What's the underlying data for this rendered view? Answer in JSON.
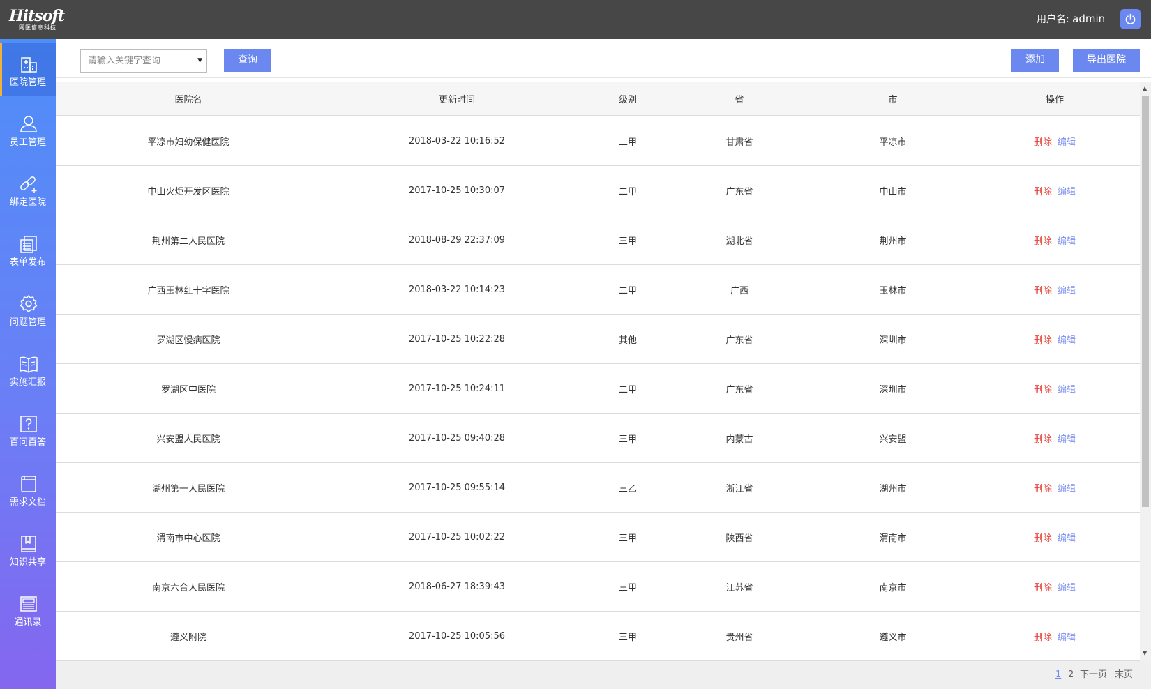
{
  "header": {
    "logo_text": "Hitsoft",
    "logo_sub": "网医信息科技",
    "user_label": "用户名:",
    "user_name": "admin"
  },
  "sidebar": {
    "items": [
      {
        "label": "医院管理",
        "icon": "hospital-icon",
        "active": true
      },
      {
        "label": "员工管理",
        "icon": "user-icon"
      },
      {
        "label": "绑定医院",
        "icon": "link-icon"
      },
      {
        "label": "表单发布",
        "icon": "forms-icon"
      },
      {
        "label": "问题管理",
        "icon": "gear-icon"
      },
      {
        "label": "实施汇报",
        "icon": "book-open-icon"
      },
      {
        "label": "百问百答",
        "icon": "question-icon"
      },
      {
        "label": "需求文档",
        "icon": "document-icon"
      },
      {
        "label": "知识共享",
        "icon": "bookmark-book-icon"
      },
      {
        "label": "通讯录",
        "icon": "newspaper-icon"
      }
    ]
  },
  "toolbar": {
    "search_placeholder": "请输入关键字查询",
    "query_label": "查询",
    "add_label": "添加",
    "export_label": "导出医院"
  },
  "table": {
    "columns": [
      "医院名",
      "更新时间",
      "级别",
      "省",
      "市",
      "操作"
    ],
    "rows": [
      {
        "name": "平凉市妇幼保健医院",
        "time": "2018-03-22 10:16:52",
        "level": "二甲",
        "province": "甘肃省",
        "city": "平凉市"
      },
      {
        "name": "中山火炬开发区医院",
        "time": "2017-10-25 10:30:07",
        "level": "二甲",
        "province": "广东省",
        "city": "中山市"
      },
      {
        "name": "荆州第二人民医院",
        "time": "2018-08-29 22:37:09",
        "level": "三甲",
        "province": "湖北省",
        "city": "荆州市"
      },
      {
        "name": "广西玉林红十字医院",
        "time": "2018-03-22 10:14:23",
        "level": "二甲",
        "province": "广西",
        "city": "玉林市"
      },
      {
        "name": "罗湖区慢病医院",
        "time": "2017-10-25 10:22:28",
        "level": "其他",
        "province": "广东省",
        "city": "深圳市"
      },
      {
        "name": "罗湖区中医院",
        "time": "2017-10-25 10:24:11",
        "level": "二甲",
        "province": "广东省",
        "city": "深圳市"
      },
      {
        "name": "兴安盟人民医院",
        "time": "2017-10-25 09:40:28",
        "level": "三甲",
        "province": "内蒙古",
        "city": "兴安盟"
      },
      {
        "name": "湖州第一人民医院",
        "time": "2017-10-25 09:55:14",
        "level": "三乙",
        "province": "浙江省",
        "city": "湖州市"
      },
      {
        "name": "渭南市中心医院",
        "time": "2017-10-25 10:02:22",
        "level": "三甲",
        "province": "陕西省",
        "city": "渭南市"
      },
      {
        "name": "南京六合人民医院",
        "time": "2018-06-27 18:39:43",
        "level": "三甲",
        "province": "江苏省",
        "city": "南京市"
      },
      {
        "name": "遵义附院",
        "time": "2017-10-25 10:05:56",
        "level": "三甲",
        "province": "贵州省",
        "city": "遵义市"
      }
    ],
    "delete_label": "删除",
    "edit_label": "编辑"
  },
  "pagination": {
    "pages": [
      "1",
      "2"
    ],
    "current": "1",
    "next_label": "下一页",
    "last_label": "末页"
  },
  "colors": {
    "topbar": "#474747",
    "accent": "#6b87f0",
    "delete": "#e8423a",
    "edit": "#7a8ef0",
    "sidebar_top": "#4e8ef8",
    "sidebar_bottom": "#8466ef"
  }
}
